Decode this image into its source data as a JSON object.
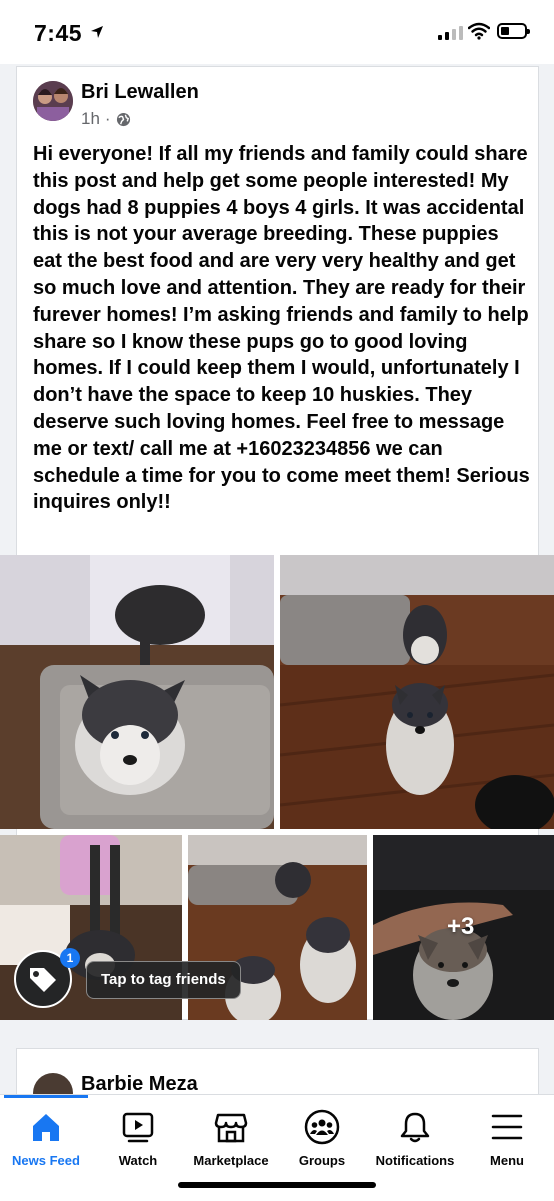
{
  "status_bar": {
    "time": "7:45"
  },
  "post": {
    "author": "Bri Lewallen",
    "time_ago": "1h",
    "separator": "·",
    "text": "Hi everyone! If all my friends and family could share this post and help get some people interested! My dogs had 8 puppies 4 boys 4 girls. It was accidental this is not your average breeding. These puppies eat the best food and are very very healthy and get so much love and attention. They are ready for their furever homes! I’m asking friends and family to help share so I know these pups go to good loving homes. If I could keep them I would, unfortunately I don’t have the space to keep 10 huskies. They deserve such loving homes. Feel free to message me or text/ call me at +16023234856 we can schedule a time for you to come meet them! Serious inquires only!!",
    "tag_tooltip": "Tap to tag friends",
    "tag_badge_count": "1",
    "more_photos": "+3"
  },
  "next_post": {
    "author": "Barbie Meza"
  },
  "tabbar": {
    "tabs": [
      {
        "label": "News Feed",
        "icon": "home-icon",
        "active": true
      },
      {
        "label": "Watch",
        "icon": "watch-icon"
      },
      {
        "label": "Marketplace",
        "icon": "marketplace-icon"
      },
      {
        "label": "Groups",
        "icon": "groups-icon"
      },
      {
        "label": "Notifications",
        "icon": "bell-icon"
      },
      {
        "label": "Menu",
        "icon": "menu-icon"
      }
    ]
  },
  "colors": {
    "accent": "#1877f2",
    "text": "#050505",
    "secondary": "#65676b"
  }
}
